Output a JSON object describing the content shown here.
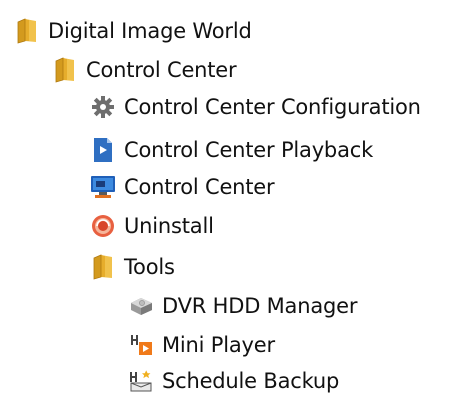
{
  "tree": {
    "items": [
      {
        "label": "Digital Image World",
        "icon": "folder-icon",
        "level": 0
      },
      {
        "label": "Control Center",
        "icon": "folder-icon",
        "level": 1
      },
      {
        "label": "Control Center Configuration",
        "icon": "gear-icon",
        "level": 2
      },
      {
        "label": "Control Center Playback",
        "icon": "playback-icon",
        "level": 2
      },
      {
        "label": "Control Center",
        "icon": "monitor-icon",
        "level": 2
      },
      {
        "label": "Uninstall",
        "icon": "uninstall-icon",
        "level": 2
      },
      {
        "label": "Tools",
        "icon": "folder-icon",
        "level": 2
      },
      {
        "label": "DVR HDD Manager",
        "icon": "hdd-icon",
        "level": 3
      },
      {
        "label": "Mini Player",
        "icon": "mini-player-icon",
        "level": 3
      },
      {
        "label": "Schedule Backup",
        "icon": "schedule-backup-icon",
        "level": 3
      }
    ]
  },
  "colors": {
    "folder": "#e8b43a",
    "folder_dark": "#c98e17",
    "gear": "#6f6f6f",
    "playback": "#2f6fc2",
    "monitor": "#1f5fb8",
    "uninstall": "#e05a3a",
    "text": "#111111"
  }
}
